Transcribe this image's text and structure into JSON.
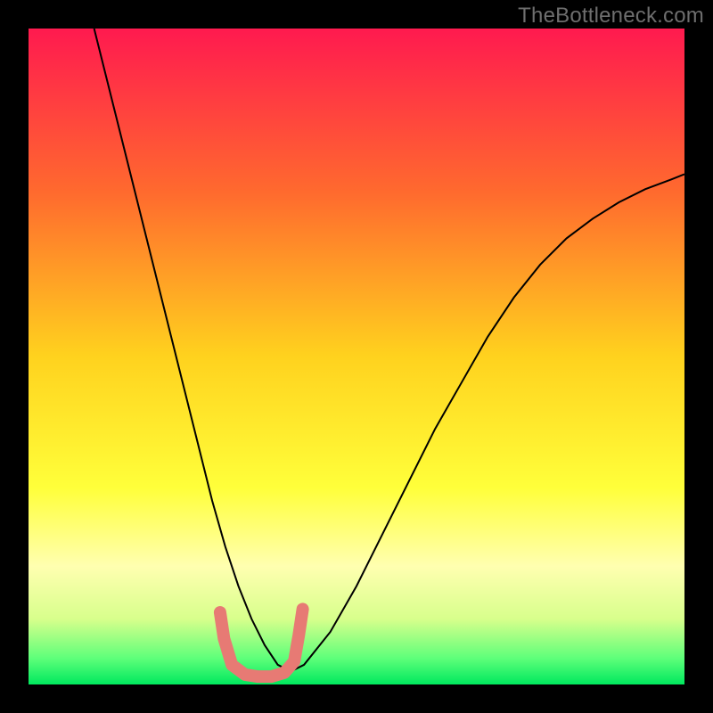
{
  "watermark": "TheBottleneck.com",
  "chart_data": {
    "type": "line",
    "title": "",
    "xlabel": "",
    "ylabel": "",
    "xlim": [
      0,
      100
    ],
    "ylim": [
      0,
      100
    ],
    "grid": false,
    "background_gradient_stops": [
      {
        "offset": 0.0,
        "color": "#ff1a4f"
      },
      {
        "offset": 0.25,
        "color": "#ff6a2e"
      },
      {
        "offset": 0.5,
        "color": "#ffd21e"
      },
      {
        "offset": 0.7,
        "color": "#ffff3a"
      },
      {
        "offset": 0.82,
        "color": "#ffffb0"
      },
      {
        "offset": 0.9,
        "color": "#d8ff8c"
      },
      {
        "offset": 0.96,
        "color": "#5eff7a"
      },
      {
        "offset": 1.0,
        "color": "#00e85e"
      }
    ],
    "series": [
      {
        "name": "curve",
        "stroke": "#000000",
        "stroke_width": 2,
        "x": [
          10,
          12,
          14,
          16,
          18,
          20,
          22,
          24,
          26,
          28,
          30,
          32,
          34,
          36,
          38,
          40,
          42,
          46,
          50,
          54,
          58,
          62,
          66,
          70,
          74,
          78,
          82,
          86,
          90,
          94,
          98,
          100
        ],
        "y": [
          100,
          92,
          84,
          76,
          68,
          60,
          52,
          44,
          36,
          28,
          21,
          15,
          10,
          6,
          3,
          2,
          3,
          8,
          15,
          23,
          31,
          39,
          46,
          53,
          59,
          64,
          68,
          71,
          73.5,
          75.5,
          77,
          77.8
        ]
      },
      {
        "name": "marker-cluster",
        "stroke": "#e77a74",
        "stroke_width": 14,
        "linecap": "round",
        "x": [
          29.2,
          29.8,
          31.0,
          33.0,
          35.0,
          37.0,
          39.0,
          40.5,
          41.2,
          41.8
        ],
        "y": [
          11.0,
          7.0,
          3.0,
          1.5,
          1.2,
          1.2,
          1.8,
          3.5,
          7.5,
          11.5
        ]
      }
    ]
  }
}
